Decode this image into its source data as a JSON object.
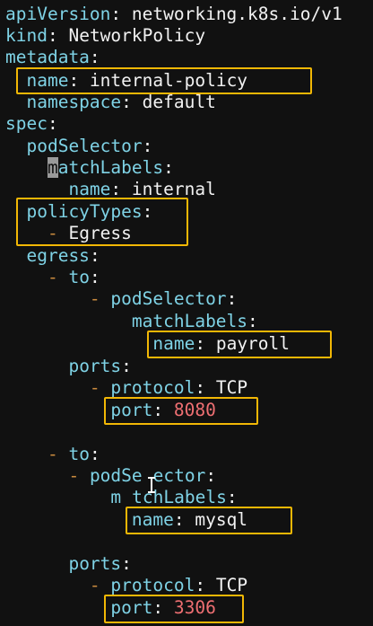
{
  "colors": {
    "background": "#111111",
    "key": "#7fd3e6",
    "value": "#f2f2f2",
    "number": "#ee6f72",
    "list_dash": "#c98a3e",
    "highlight_box": "#f2b705"
  },
  "yaml": {
    "l01": {
      "key": "apiVersion",
      "colon": ":",
      "value": " networking.k8s.io/v1"
    },
    "l02": {
      "key": "kind",
      "colon": ":",
      "value": " NetworkPolicy"
    },
    "l03": {
      "key": "metadata",
      "colon": ":"
    },
    "l04": {
      "indent": "  ",
      "key": "name",
      "colon": ":",
      "value": " internal-policy"
    },
    "l05": {
      "indent": "  ",
      "key": "namespace",
      "colon": ":",
      "value": " default"
    },
    "l06": {
      "key": "spec",
      "colon": ":"
    },
    "l07": {
      "indent": "  ",
      "key": "podSelector",
      "colon": ":"
    },
    "l08": {
      "indent": "    ",
      "cursor_char": "m",
      "key_rest": "atchLabels",
      "colon": ":"
    },
    "l09": {
      "indent": "      ",
      "key": "name",
      "colon": ":",
      "value": " internal"
    },
    "l10": {
      "indent": "  ",
      "key": "policyTypes",
      "colon": ":"
    },
    "l11": {
      "indent": "    ",
      "dash": "-",
      "value": " Egress"
    },
    "l12": {
      "indent": "  ",
      "key": "egress",
      "colon": ":"
    },
    "l13": {
      "indent": "    ",
      "dash": "-",
      "key": " to",
      "colon": ":"
    },
    "l14": {
      "indent": "        ",
      "dash": "-",
      "key": " podSelector",
      "colon": ":"
    },
    "l15": {
      "indent": "            ",
      "key": "matchLabels",
      "colon": ":"
    },
    "l16": {
      "indent": "              ",
      "key": "name",
      "colon": ":",
      "value": " payroll"
    },
    "l17": {
      "indent": "      ",
      "key": "ports",
      "colon": ":"
    },
    "l18": {
      "indent": "        ",
      "dash": "-",
      "key": " protocol",
      "colon": ":",
      "value": " TCP"
    },
    "l19": {
      "indent": "          ",
      "key": "port",
      "colon": ":",
      "number": " 8080"
    },
    "l21": {
      "indent": "    ",
      "dash": "-",
      "key": " to",
      "colon": ":"
    },
    "l22": {
      "indent": "      ",
      "dash": "-",
      "key_a": " podSe",
      "key_b": "ector",
      "colon": ":"
    },
    "l23": {
      "indent": "          ",
      "key_a": "m",
      "key_b": "tchLabels",
      "colon": ":"
    },
    "l24": {
      "indent": "            ",
      "key": "name",
      "colon": ":",
      "value": " mysql"
    },
    "l26": {
      "indent": "      ",
      "key": "ports",
      "colon": ":"
    },
    "l27": {
      "indent": "        ",
      "dash": "-",
      "key": " protocol",
      "colon": ":",
      "value": " TCP"
    },
    "l28": {
      "indent": "          ",
      "key": "port",
      "colon": ":",
      "number": " 3306"
    }
  }
}
